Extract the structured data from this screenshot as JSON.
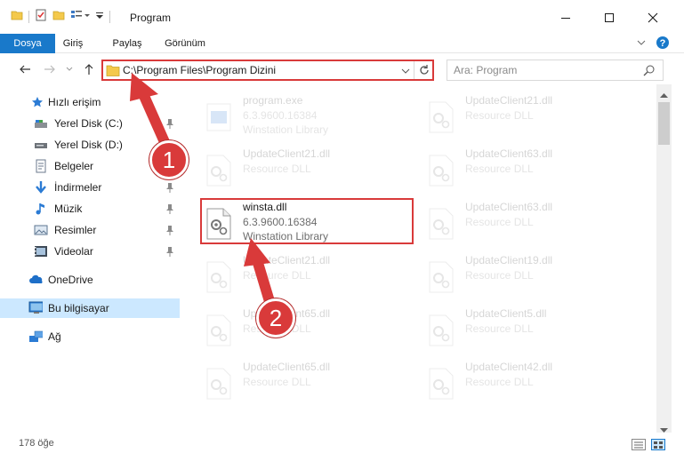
{
  "window": {
    "title": "Program",
    "minimize_icon": "minimize-icon",
    "maximize_icon": "maximize-icon",
    "close_icon": "close-icon"
  },
  "ribbon": {
    "tabs": [
      {
        "label": "Dosya"
      },
      {
        "label": "Giriş"
      },
      {
        "label": "Paylaş"
      },
      {
        "label": "Görünüm"
      }
    ]
  },
  "nav": {
    "address": "C:\\Program Files\\Program Dizini",
    "search_placeholder": "Ara: Program"
  },
  "sidebar": {
    "items": [
      {
        "label": "Hızlı erişim",
        "icon": "star-icon",
        "pinned": false
      },
      {
        "label": "Yerel Disk (C:)",
        "icon": "drive-icon",
        "pinned": true
      },
      {
        "label": "Yerel Disk (D:)",
        "icon": "drive-icon",
        "pinned": true
      },
      {
        "label": "Belgeler",
        "icon": "document-icon",
        "pinned": true
      },
      {
        "label": "İndirmeler",
        "icon": "download-icon",
        "pinned": true
      },
      {
        "label": "Müzik",
        "icon": "music-icon",
        "pinned": true
      },
      {
        "label": "Resimler",
        "icon": "picture-icon",
        "pinned": true
      },
      {
        "label": "Videolar",
        "icon": "video-icon",
        "pinned": true
      },
      {
        "label": "OneDrive",
        "icon": "cloud-icon",
        "pinned": false
      },
      {
        "label": "Bu bilgisayar",
        "icon": "computer-icon",
        "pinned": false
      },
      {
        "label": "Ağ",
        "icon": "network-icon",
        "pinned": false
      }
    ]
  },
  "files": [
    {
      "name": "program.exe",
      "version": "6.3.9600.16384",
      "desc": "Winstation Library",
      "faded": true
    },
    {
      "name": "UpdateClient21.dll",
      "version": "",
      "desc": "Resource DLL",
      "faded": true
    },
    {
      "name": "UpdateClient21.dll",
      "version": "",
      "desc": "Resource DLL",
      "faded": true
    },
    {
      "name": "UpdateClient63.dll",
      "version": "",
      "desc": "Resource DLL",
      "faded": true
    },
    {
      "name": "winsta.dll",
      "version": "6.3.9600.16384",
      "desc": "Winstation Library",
      "faded": false
    },
    {
      "name": "UpdateClient63.dll",
      "version": "",
      "desc": "Resource DLL",
      "faded": true
    },
    {
      "name": "UpdateClient21.dll",
      "version": "",
      "desc": "Resource DLL",
      "faded": true
    },
    {
      "name": "UpdateClient19.dll",
      "version": "",
      "desc": "Resource DLL",
      "faded": true
    },
    {
      "name": "UpdateClient65.dll",
      "version": "",
      "desc": "Resource DLL",
      "faded": true
    },
    {
      "name": "UpdateClient5.dll",
      "version": "",
      "desc": "Resource DLL",
      "faded": true
    },
    {
      "name": "UpdateClient65.dll",
      "version": "",
      "desc": "Resource DLL",
      "faded": true
    },
    {
      "name": "UpdateClient42.dll",
      "version": "",
      "desc": "Resource DLL",
      "faded": true
    }
  ],
  "status": {
    "item_count": "178 öğe"
  },
  "annotations": {
    "step1": "1",
    "step2": "2"
  },
  "colors": {
    "accent": "#1979ca",
    "highlight": "#d93a3a",
    "selected": "#cce8ff"
  }
}
